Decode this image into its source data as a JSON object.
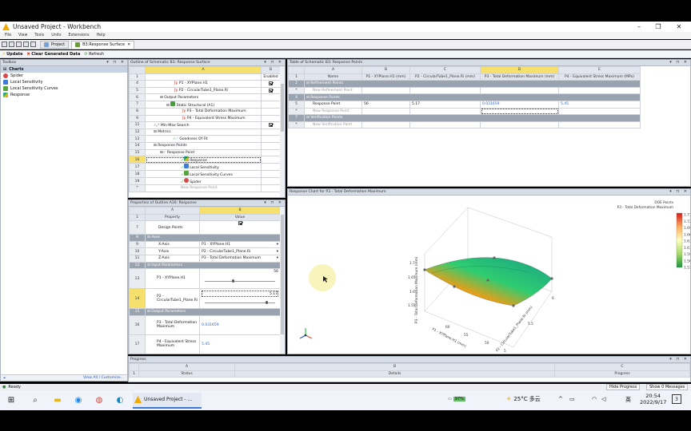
{
  "window": {
    "title": "Unsaved Project - Workbench"
  },
  "menu": [
    "File",
    "View",
    "Tools",
    "Units",
    "Extensions",
    "Help"
  ],
  "tabs": [
    {
      "label": "Project"
    },
    {
      "label": "B3:Response Surface"
    }
  ],
  "toolbar2": {
    "update": "Update",
    "clear": "Clear Generated Data",
    "refresh": "Refresh"
  },
  "toolbox": {
    "title": "Toolbox",
    "header": "Charts",
    "items": [
      "Spider",
      "Local Sensitivity",
      "Local Sensitivity Curves",
      "Response"
    ],
    "footer": "View All / Customize..."
  },
  "outline": {
    "title": "Outline of Schematic B3: Response Surface",
    "cols": [
      "A",
      "B"
    ],
    "enabled": "Enabled",
    "rows": [
      {
        "n": "1",
        "text": ""
      },
      {
        "n": "4",
        "text": "P1 - XYPlane.H1"
      },
      {
        "n": "5",
        "text": "P2 - CircularTube1_Plane.Ri"
      },
      {
        "n": "6",
        "text": "Output Parameters"
      },
      {
        "n": "7",
        "text": "Static Structural (A1)"
      },
      {
        "n": "8",
        "text": "P3 - Total Deformation Maximum"
      },
      {
        "n": "9",
        "text": "P4 - Equivalent Stress Maximum"
      },
      {
        "n": "11",
        "text": "Min-Max Search"
      },
      {
        "n": "12",
        "text": "Metrics"
      },
      {
        "n": "13",
        "text": "Goodness Of Fit"
      },
      {
        "n": "14",
        "text": "Response Points"
      },
      {
        "n": "15",
        "text": "Response Point"
      },
      {
        "n": "16",
        "text": "Response"
      },
      {
        "n": "17",
        "text": "Local Sensitivity"
      },
      {
        "n": "18",
        "text": "Local Sensitivity Curves"
      },
      {
        "n": "19",
        "text": "Spider"
      },
      {
        "n": "*",
        "text": "New Response Point"
      }
    ]
  },
  "properties": {
    "title": "Properties of Outline A16: Response",
    "cols": [
      "A",
      "B"
    ],
    "head": {
      "property": "Property",
      "value": "Value"
    },
    "rows": [
      {
        "n": "7",
        "prop": "Design Points",
        "value": ""
      },
      {
        "n": "8",
        "section": "Axes"
      },
      {
        "n": "9",
        "prop": "X-Axis",
        "value": "P1 - XYPlane.H1"
      },
      {
        "n": "10",
        "prop": "Y-Axis",
        "value": "P2 - CircularTube1_Plane.Ri"
      },
      {
        "n": "11",
        "prop": "Z-Axis",
        "value": "P3 - Total Deformation Maximum"
      },
      {
        "n": "12",
        "section": "Input Parameters"
      },
      {
        "n": "13",
        "prop": "P1 - XYPlane.H1",
        "value": "56"
      },
      {
        "n": "14",
        "prop": "P2 - CircularTube1_Plane.Ri",
        "value": "5.17"
      },
      {
        "n": "15",
        "section": "Output Parameters"
      },
      {
        "n": "16",
        "prop": "P3 - Total Deformation Maximum",
        "value": "0.031659"
      },
      {
        "n": "17",
        "prop": "P4 - Equivalent Stress Maximum",
        "value": "5.45"
      }
    ]
  },
  "table": {
    "title": "Table of Schematic B3: Response Points",
    "cols": [
      "A",
      "B",
      "C",
      "D",
      "E"
    ],
    "headers": [
      "Name",
      "P1 - XYPlane.H1 (mm)",
      "P2 - CircularTube1_Plane.Ri (mm)",
      "P3 - Total Deformation Maximum (mm)",
      "P4 - Equivalent Stress Maximum (MPa)"
    ],
    "rows": [
      {
        "n": "2",
        "section": "Refinement Points"
      },
      {
        "n": "*",
        "ghost": "New Refinement Point"
      },
      {
        "n": "4",
        "section": "Response Points"
      },
      {
        "n": "5",
        "name": "Response Point",
        "p1": "56",
        "p2": "5.17",
        "p3": "0.031659",
        "p4": "5.45"
      },
      {
        "n": "*",
        "ghost": "New Response Point"
      },
      {
        "n": "7",
        "section": "Verification Points"
      },
      {
        "n": "*",
        "ghost": "New Verification Point"
      }
    ]
  },
  "chart": {
    "title": "Response Chart for P3 - Total Deformation Maximum",
    "legend": {
      "line1": "DOE Points",
      "line2": "P3 - Total Deformation Maximum",
      "ticks": [
        "1.73",
        "1.72",
        "1.69",
        "1.66",
        "1.63",
        "1.61",
        "1.59",
        "1.56",
        "1.53"
      ],
      "exp": "1e-10^?"
    },
    "zlabel": "P3 - Total Deformation Maximum (mm)",
    "zticks": [
      "1.7",
      "1.65",
      "1.6",
      "1.55"
    ],
    "xlabel": "P1 - XYPlane.H1 (mm)",
    "xticks": [
      "60",
      "55",
      "50"
    ],
    "ylabel": "P2 - CircularTube1_Plane.Ri (mm)",
    "yticks": [
      "5",
      "5.5",
      "6"
    ]
  },
  "progress": {
    "title": "Progress",
    "cols": [
      "A",
      "B",
      "C"
    ],
    "headers": [
      "Status",
      "Details",
      "Progress"
    ],
    "row_n": "1"
  },
  "status": {
    "text": "Ready",
    "hide_progress": "Hide Progress",
    "messages": "Show 0 Messages"
  },
  "taskbar": {
    "app_label": "Unsaved Project - ...",
    "battery": "97%",
    "weather": "25°C 多云",
    "ime": "英",
    "time": "20:54",
    "date": "2022/9/17",
    "notif": "3"
  },
  "colors": {
    "accent": "#f2a900",
    "panel_header": "#d6dde7",
    "selection": "#f5e06e",
    "section": "#9aa4b0"
  }
}
